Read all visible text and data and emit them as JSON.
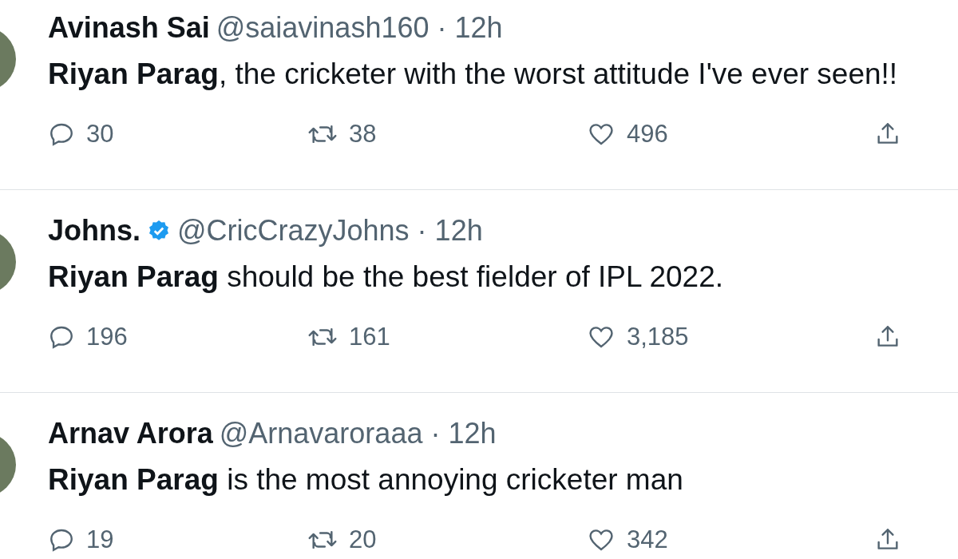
{
  "tweets": [
    {
      "author": "Avinash Sai",
      "verified": false,
      "meta": "@saiavinash160 · 12h",
      "text": "**Riyan Parag**, the cricketer with the worst attitude  I've ever seen!!",
      "replies": "30",
      "retweets": "38",
      "likes": "496"
    },
    {
      "author": "Johns.",
      "verified": true,
      "meta": "@CricCrazyJohns · 12h",
      "text": "**Riyan Parag** should be the best fielder of IPL 2022.",
      "replies": "196",
      "retweets": "161",
      "likes": "3,185"
    },
    {
      "author": "Arnav Arora",
      "verified": false,
      "meta": "@Arnavaroraaa · 12h",
      "text": "**Riyan Parag** is the most annoying cricketer man",
      "replies": "19",
      "retweets": "20",
      "likes": "342"
    }
  ]
}
